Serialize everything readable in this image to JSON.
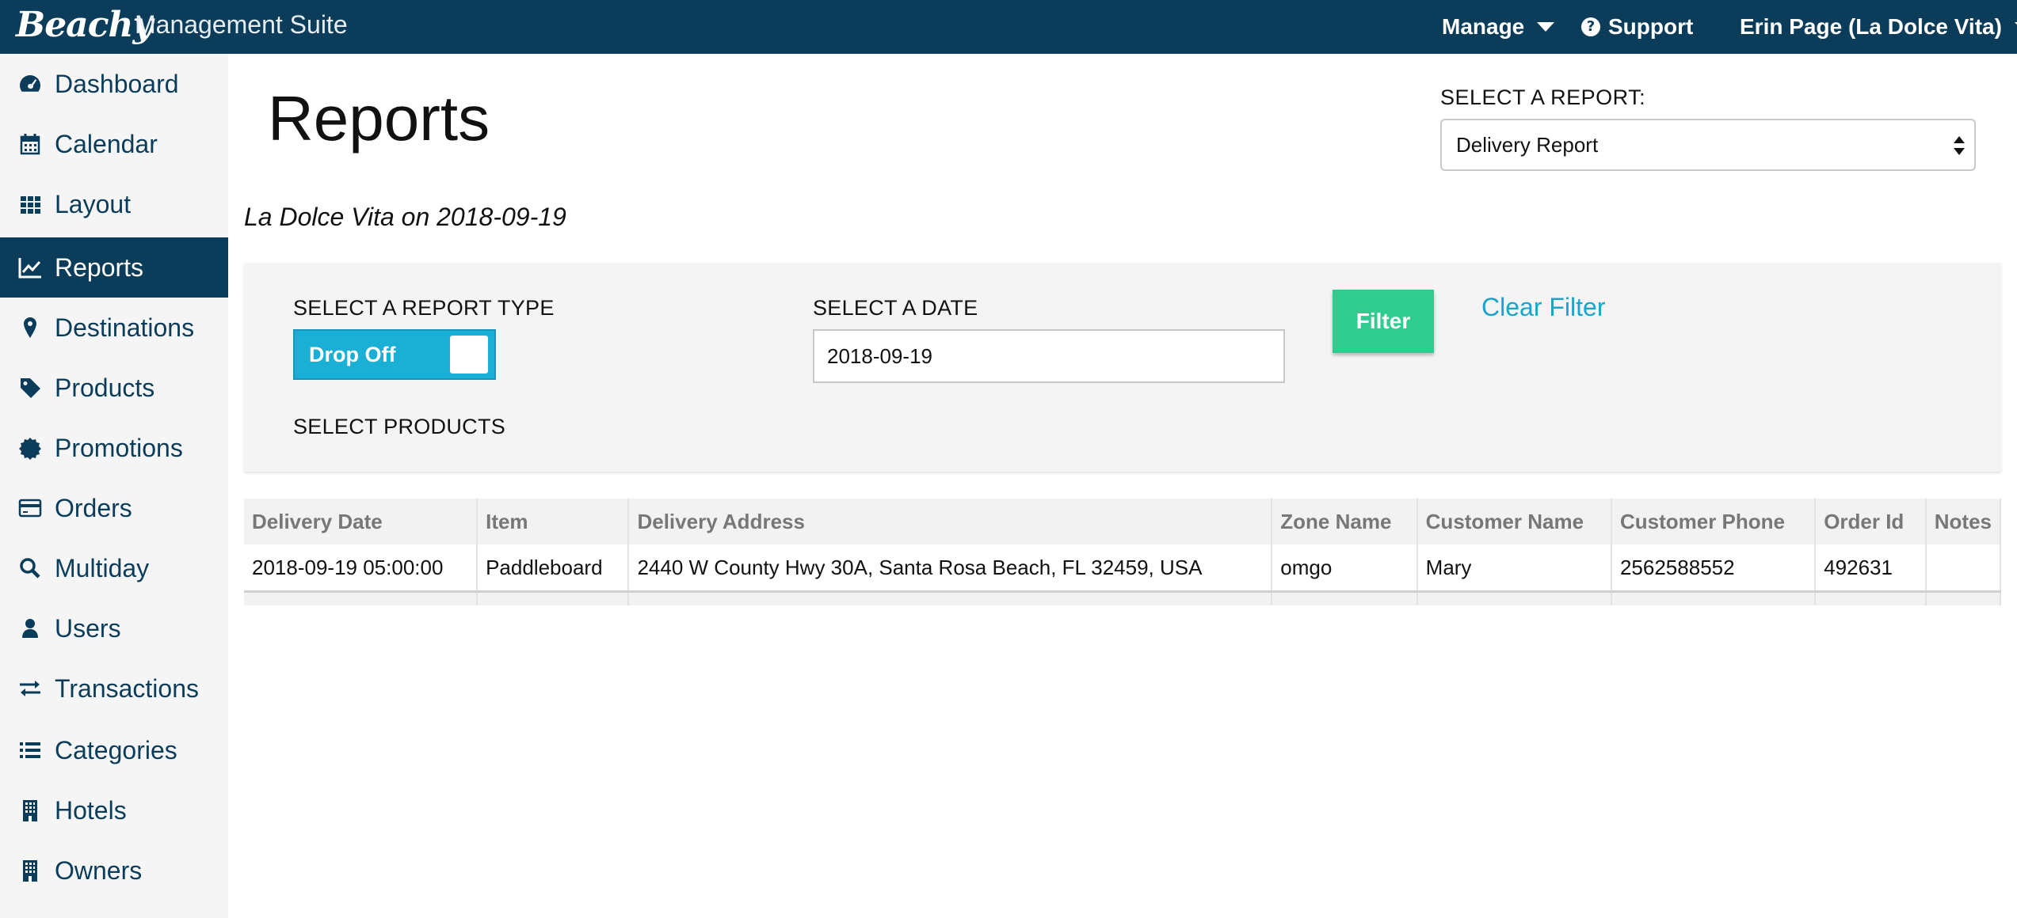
{
  "topbar": {
    "logo": "Beachy",
    "suite": "Management Suite",
    "manage": "Manage",
    "support": "Support",
    "user": "Erin Page (La Dolce Vita)"
  },
  "sidebar": {
    "items": [
      {
        "label": "Dashboard",
        "icon": "dashboard-icon"
      },
      {
        "label": "Calendar",
        "icon": "calendar-icon"
      },
      {
        "label": "Layout",
        "icon": "grid-icon"
      },
      {
        "label": "Reports",
        "icon": "line-chart-icon",
        "active": true
      },
      {
        "label": "Destinations",
        "icon": "map-marker-icon"
      },
      {
        "label": "Products",
        "icon": "tag-icon"
      },
      {
        "label": "Promotions",
        "icon": "badge-icon"
      },
      {
        "label": "Orders",
        "icon": "credit-card-icon"
      },
      {
        "label": "Multiday",
        "icon": "search-icon"
      },
      {
        "label": "Users",
        "icon": "user-icon"
      },
      {
        "label": "Transactions",
        "icon": "exchange-icon"
      },
      {
        "label": "Categories",
        "icon": "list-icon"
      },
      {
        "label": "Hotels",
        "icon": "building-icon"
      },
      {
        "label": "Owners",
        "icon": "building-icon"
      }
    ]
  },
  "main": {
    "title": "Reports",
    "select_report_label": "SELECT A REPORT:",
    "selected_report": "Delivery Report",
    "subtitle": "La Dolce Vita on 2018-09-19"
  },
  "filter": {
    "report_type_label": "SELECT A REPORT TYPE",
    "report_type_value": "Drop Off",
    "date_label": "SELECT A DATE",
    "date_value": "2018-09-19",
    "products_label": "SELECT PRODUCTS",
    "filter_button": "Filter",
    "clear_filter": "Clear Filter"
  },
  "table": {
    "headers": [
      "Delivery Date",
      "Item",
      "Delivery Address",
      "Zone Name",
      "Customer Name",
      "Customer Phone",
      "Order Id",
      "Notes"
    ],
    "rows": [
      [
        "2018-09-19 05:00:00",
        "Paddleboard",
        "2440 W County Hwy 30A, Santa Rosa Beach, FL 32459, USA",
        "omgo",
        "Mary",
        "2562588552",
        "492631",
        ""
      ]
    ]
  },
  "colors": {
    "navy": "#0b3d5b",
    "toggle_blue": "#1aafd4",
    "filter_green": "#2ecc8f",
    "link_blue": "#1aa4cc"
  }
}
